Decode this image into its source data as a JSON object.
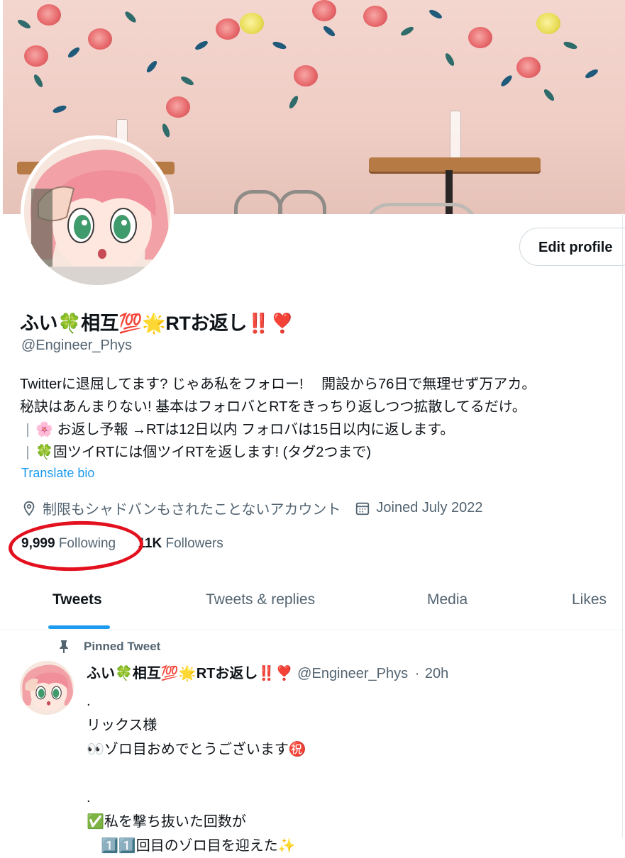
{
  "profile": {
    "display_name": "ふい🍀相互💯🌟RTお返し‼️❣️",
    "handle": "@Engineer_Phys",
    "edit_button": "Edit profile",
    "bio": [
      "Twitterに退屈してます? じゃあ私をフォロー!　 開設から76日で無理せず万アカ。",
      "秘訣はあんまりない! 基本はフォロバとRTをきっちり返しつつ拡散してるだけ。",
      "🌸 お返し予報 →RTは12日以内 フォロバは15日以内に返します。",
      "🍀固ツイRTには個ツイRTを返します! (タグ2つまで)"
    ],
    "bio_bar": "|",
    "translate_label": "Translate bio",
    "location": "制限もシャドバンもされたことないアカウント",
    "joined": "Joined July 2022",
    "following_count": "9,999",
    "following_label": "Following",
    "followers_count": "11K",
    "followers_label": "Followers"
  },
  "tabs": [
    {
      "label": "Tweets",
      "active": true
    },
    {
      "label": "Tweets & replies",
      "active": false
    },
    {
      "label": "Media",
      "active": false
    },
    {
      "label": "Likes",
      "active": false
    }
  ],
  "pinned_tweet": {
    "pinned_label": "Pinned Tweet",
    "author_name": "ふい🍀相互💯🌟RTお返し‼️❣️",
    "author_handle": "@Engineer_Phys",
    "separator": "·",
    "time": "20h",
    "lines": [
      ".",
      "リックス様",
      "👀ゾロ目おめでとうございます㊗️",
      "",
      ".",
      "✅私を撃ち抜いた回数が",
      "　1️⃣1️⃣回目のゾロ目を迎えた✨"
    ]
  },
  "colors": {
    "accent": "#1d9bf0",
    "annotation_circle": "#e3101e",
    "secondary_text": "#536471"
  },
  "icons": [
    "location-pin-icon",
    "calendar-icon",
    "pin-icon"
  ]
}
